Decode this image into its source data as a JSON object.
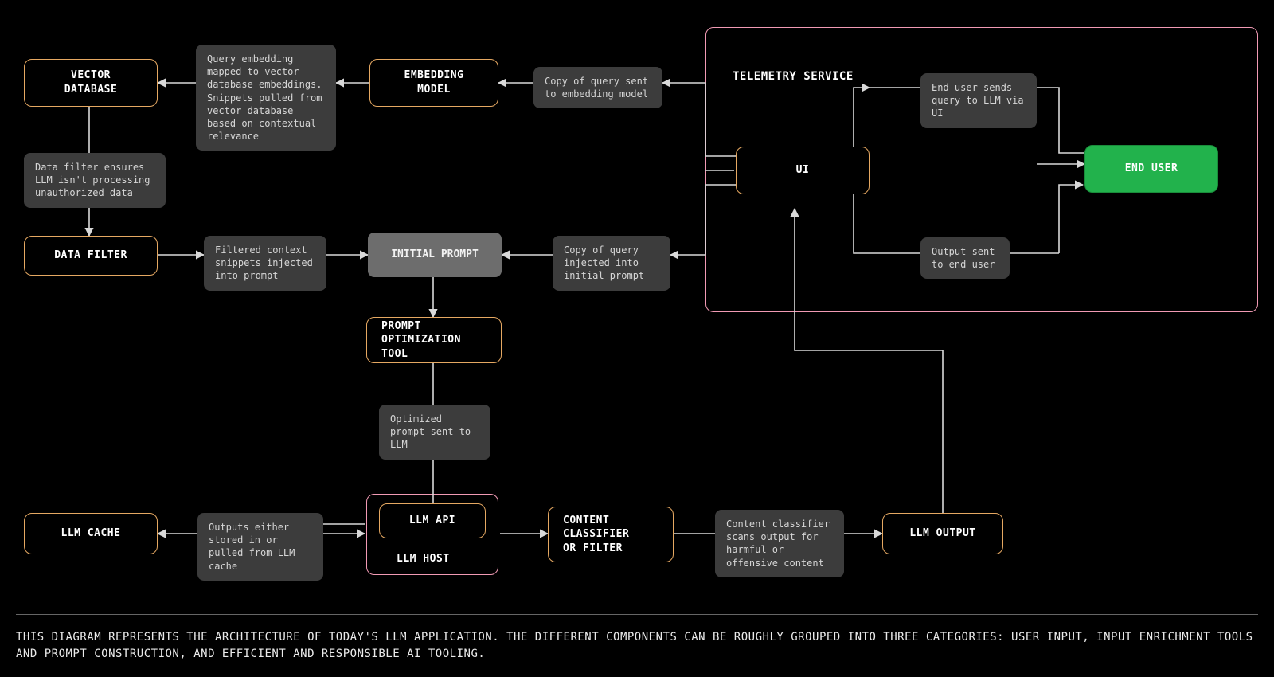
{
  "nodes": {
    "vector_db": "VECTOR\nDATABASE",
    "embedding_model": "EMBEDDING\nMODEL",
    "ui": "UI",
    "end_user": "END USER",
    "data_filter": "DATA FILTER",
    "initial_prompt": "INITIAL PROMPT",
    "prompt_opt": "PROMPT\nOPTIMIZATION TOOL",
    "llm_cache": "LLM CACHE",
    "llm_api": "LLM API",
    "llm_host": "LLM  HOST",
    "content_classifier": "CONTENT\nCLASSIFIER\nOR FILTER",
    "llm_output": "LLM OUTPUT",
    "telemetry": "TELEMETRY SERVICE"
  },
  "notes": {
    "embed_map": "Query embedding mapped to vector database embeddings. Snippets pulled from vector database based on contextual relevance",
    "copy_embed": "Copy of query sent to embedding model",
    "end_user_sends": "End user sends query to LLM via UI",
    "unauth": "Data filter ensures LLM isn't processing unauthorized data",
    "filtered_ctx": "Filtered context snippets injected into prompt",
    "copy_initial": "Copy of query injected into initial prompt",
    "output_sent": "Output sent to end user",
    "opt_sent": "Optimized prompt sent to LLM",
    "cache": "Outputs either stored in or pulled from LLM cache",
    "scan": "Content classifier scans output for harmful or offensive content"
  },
  "caption": "THIS DIAGRAM REPRESENTS THE ARCHITECTURE OF TODAY'S LLM APPLICATION. THE DIFFERENT COMPONENTS CAN BE ROUGHLY GROUPED INTO THREE CATEGORIES: USER INPUT, INPUT ENRICHMENT TOOLS AND PROMPT CONSTRUCTION, AND EFFICIENT AND RESPONSIBLE AI TOOLING."
}
